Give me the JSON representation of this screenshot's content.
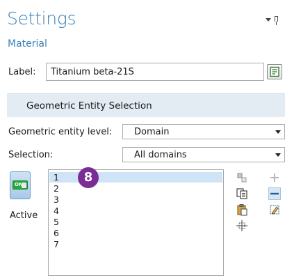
{
  "header": {
    "title": "Settings",
    "subtitle": "Material"
  },
  "label_field": {
    "label": "Label:",
    "value": "Titanium beta-21S"
  },
  "section": {
    "title": "Geometric Entity Selection"
  },
  "entity_level": {
    "label": "Geometric entity level:",
    "value": "Domain"
  },
  "selection": {
    "label": "Selection:",
    "value": "All domains"
  },
  "toggle": {
    "state_text": "ON",
    "label": "Active"
  },
  "domain_list": {
    "items": [
      "1",
      "2",
      "3",
      "4",
      "5",
      "6",
      "7"
    ],
    "selected": "1"
  },
  "badge": {
    "text": "8"
  },
  "icons": [
    "dropdown-menu-icon",
    "pin-icon",
    "label-edit-icon",
    "copy-selection-icon",
    "paste-selection-icon",
    "zoom-to-selection-icon",
    "add-icon",
    "remove-icon",
    "clear-selection-icon",
    "create-selection-icon"
  ],
  "colors": {
    "accent": "#3a80b8",
    "section_bg": "#e3ebf3",
    "selected_row": "#cfe4f7",
    "badge": "#7a2d96",
    "toggle_on": "#24a83b"
  }
}
